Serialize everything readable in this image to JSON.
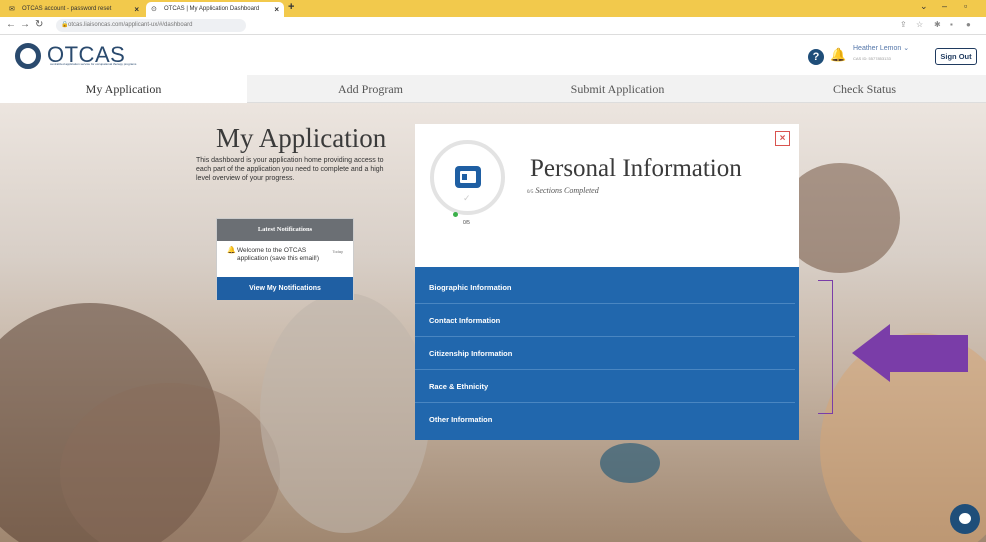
{
  "browser": {
    "tabs": [
      {
        "label": "OTCAS account - password reset"
      },
      {
        "label": "OTCAS | My Application Dashboard"
      }
    ],
    "url": "otcas.liaisoncas.com/applicant-ux/#/dashboard"
  },
  "header": {
    "logo_text": "OTCAS",
    "logo_sub": "centralized application service for occupational therapy programs",
    "user_name": "Heather Lemon",
    "user_id": "CAS ID: 5577853133",
    "sign_out": "Sign Out"
  },
  "nav": {
    "items": [
      {
        "label": "My Application"
      },
      {
        "label": "Add Program"
      },
      {
        "label": "Submit Application"
      },
      {
        "label": "Check Status"
      }
    ]
  },
  "intro": {
    "title": "My Application",
    "text": "This dashboard is your application home providing access to each part of the application you need to complete and a high level overview of your progress."
  },
  "notifications": {
    "title": "Latest Notifications",
    "item": "Welcome to the OTCAS application (save this email!)",
    "time": "Today",
    "button": "View My Notifications"
  },
  "modal": {
    "title": "Personal Information",
    "completed_num": "0/5",
    "completed_label": "Sections Completed",
    "progress": 0,
    "sections": [
      {
        "label": "Biographic Information"
      },
      {
        "label": "Contact Information"
      },
      {
        "label": "Citizenship Information"
      },
      {
        "label": "Race & Ethnicity"
      },
      {
        "label": "Other Information"
      }
    ]
  },
  "colors": {
    "accent_blue": "#2167ad",
    "annotation_purple": "#7a3da8",
    "tab_bar_yellow": "#f2c94c"
  }
}
